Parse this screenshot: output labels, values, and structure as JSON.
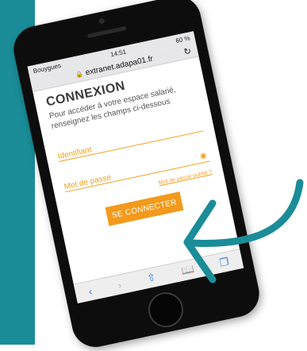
{
  "status": {
    "carrier": "Bouygues",
    "time": "14:51",
    "battery": "60 %"
  },
  "browser": {
    "url": "extranet.adapa01.fr",
    "reload_icon": "reload-icon",
    "toolbar_icons": [
      "back-icon",
      "forward-icon",
      "share-icon",
      "bookmarks-icon",
      "tabs-icon"
    ]
  },
  "login": {
    "title": "CONNEXION",
    "subtitle": "Pour accéder à votre espace salarié, renseignez les champs ci-dessous",
    "username_placeholder": "Identifiant",
    "password_placeholder": "Mot de passe",
    "forgot_password": "Mot de passe oublié ?",
    "submit": "SE CONNECTER"
  },
  "colors": {
    "accent": "#f29a1c",
    "teal": "#1a8d98",
    "phone": "#0d0d0d"
  }
}
